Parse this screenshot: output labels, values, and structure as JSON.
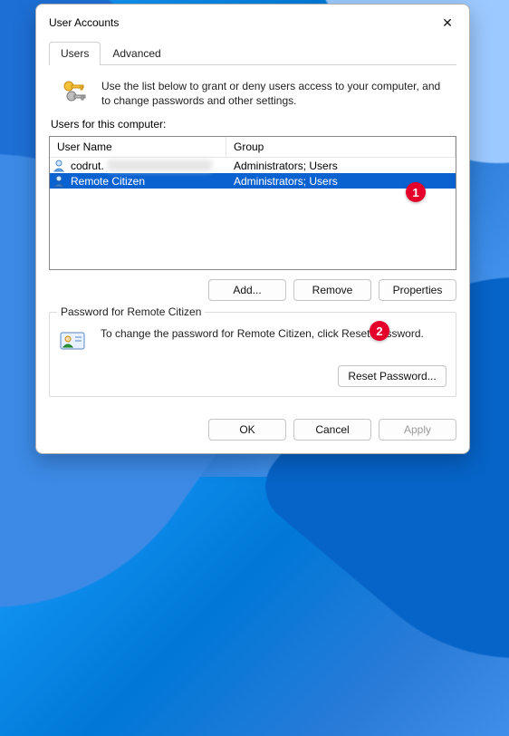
{
  "dialog": {
    "title": "User Accounts",
    "close_glyph": "✕"
  },
  "tabs": {
    "active": "Users",
    "items": [
      "Users",
      "Advanced"
    ]
  },
  "intro": {
    "text": "Use the list below to grant or deny users access to your computer, and to change passwords and other settings."
  },
  "list": {
    "label": "Users for this computer:",
    "columns": {
      "name": "User Name",
      "group": "Group"
    },
    "rows": [
      {
        "name": "codrut.",
        "group": "Administrators; Users",
        "selected": false,
        "redacted": true
      },
      {
        "name": "Remote Citizen",
        "group": "Administrators; Users",
        "selected": true,
        "redacted": false
      }
    ]
  },
  "buttons": {
    "add": "Add...",
    "remove": "Remove",
    "properties": "Properties",
    "reset_pw": "Reset Password...",
    "ok": "OK",
    "cancel": "Cancel",
    "apply": "Apply"
  },
  "password_panel": {
    "legend": "Password for Remote Citizen",
    "text": "To change the password for Remote Citizen, click Reset Password."
  },
  "callouts": {
    "one": "1",
    "two": "2"
  }
}
